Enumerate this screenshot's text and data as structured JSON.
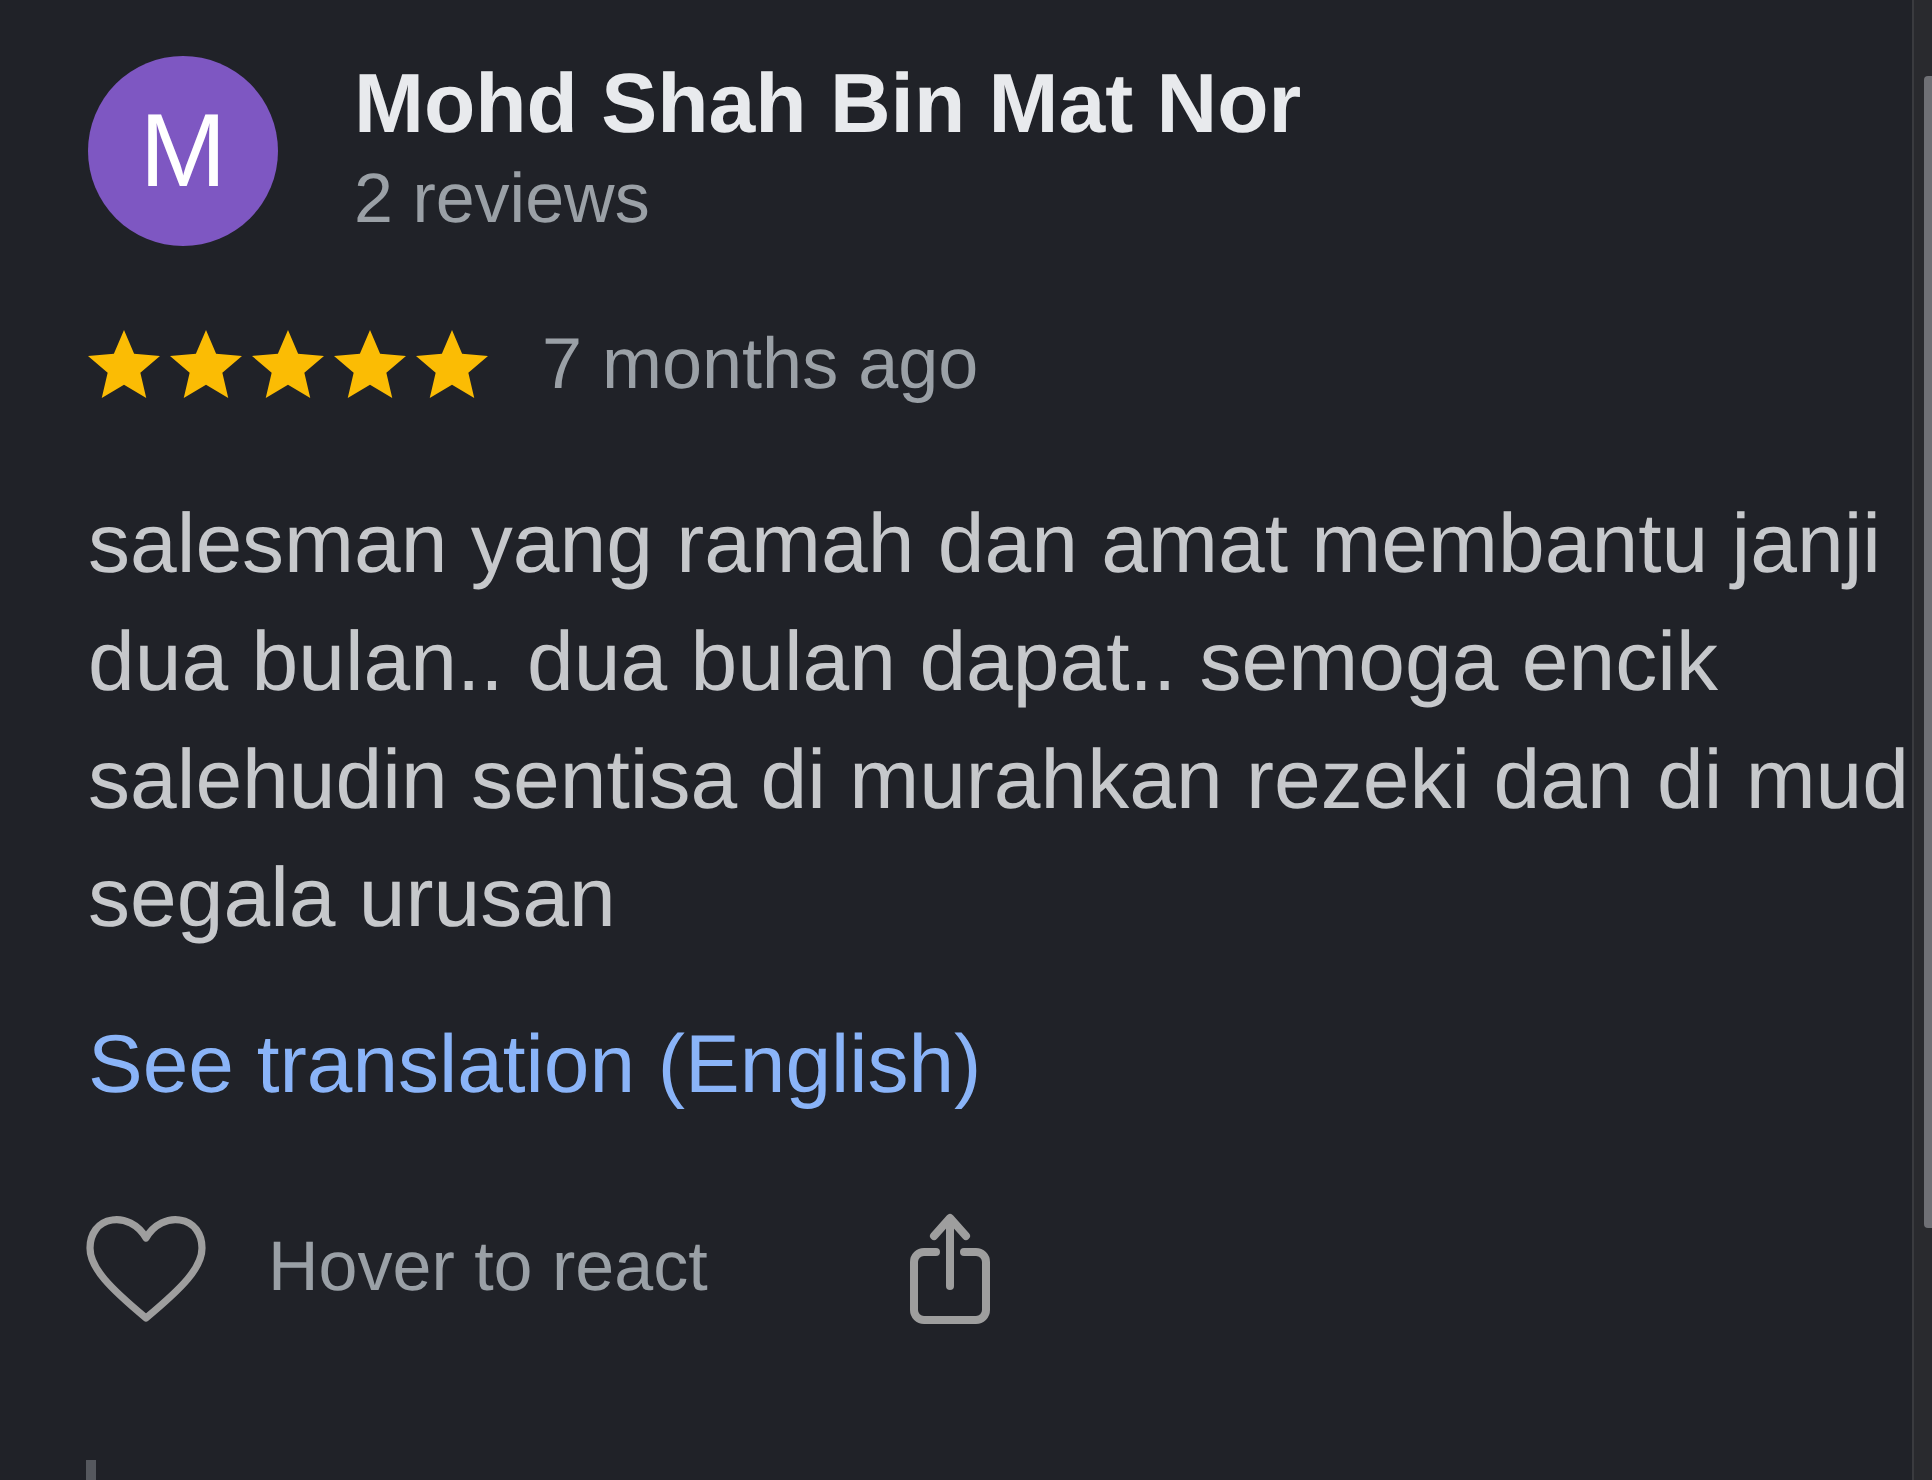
{
  "reviewer": {
    "avatar_letter": "M",
    "name": "Mohd Shah Bin Mat Nor",
    "review_count": "2 reviews"
  },
  "review": {
    "stars": 5,
    "time": "7 months ago",
    "text_lines": [
      "salesman yang ramah dan amat membantu janji",
      "dua bulan.. dua bulan dapat.. semoga encik",
      "salehudin sentisa di murahkan rezeki dan di mud",
      "segala urusan"
    ],
    "translation_link": "See translation (English)"
  },
  "actions": {
    "react_label": "Hover to react"
  }
}
